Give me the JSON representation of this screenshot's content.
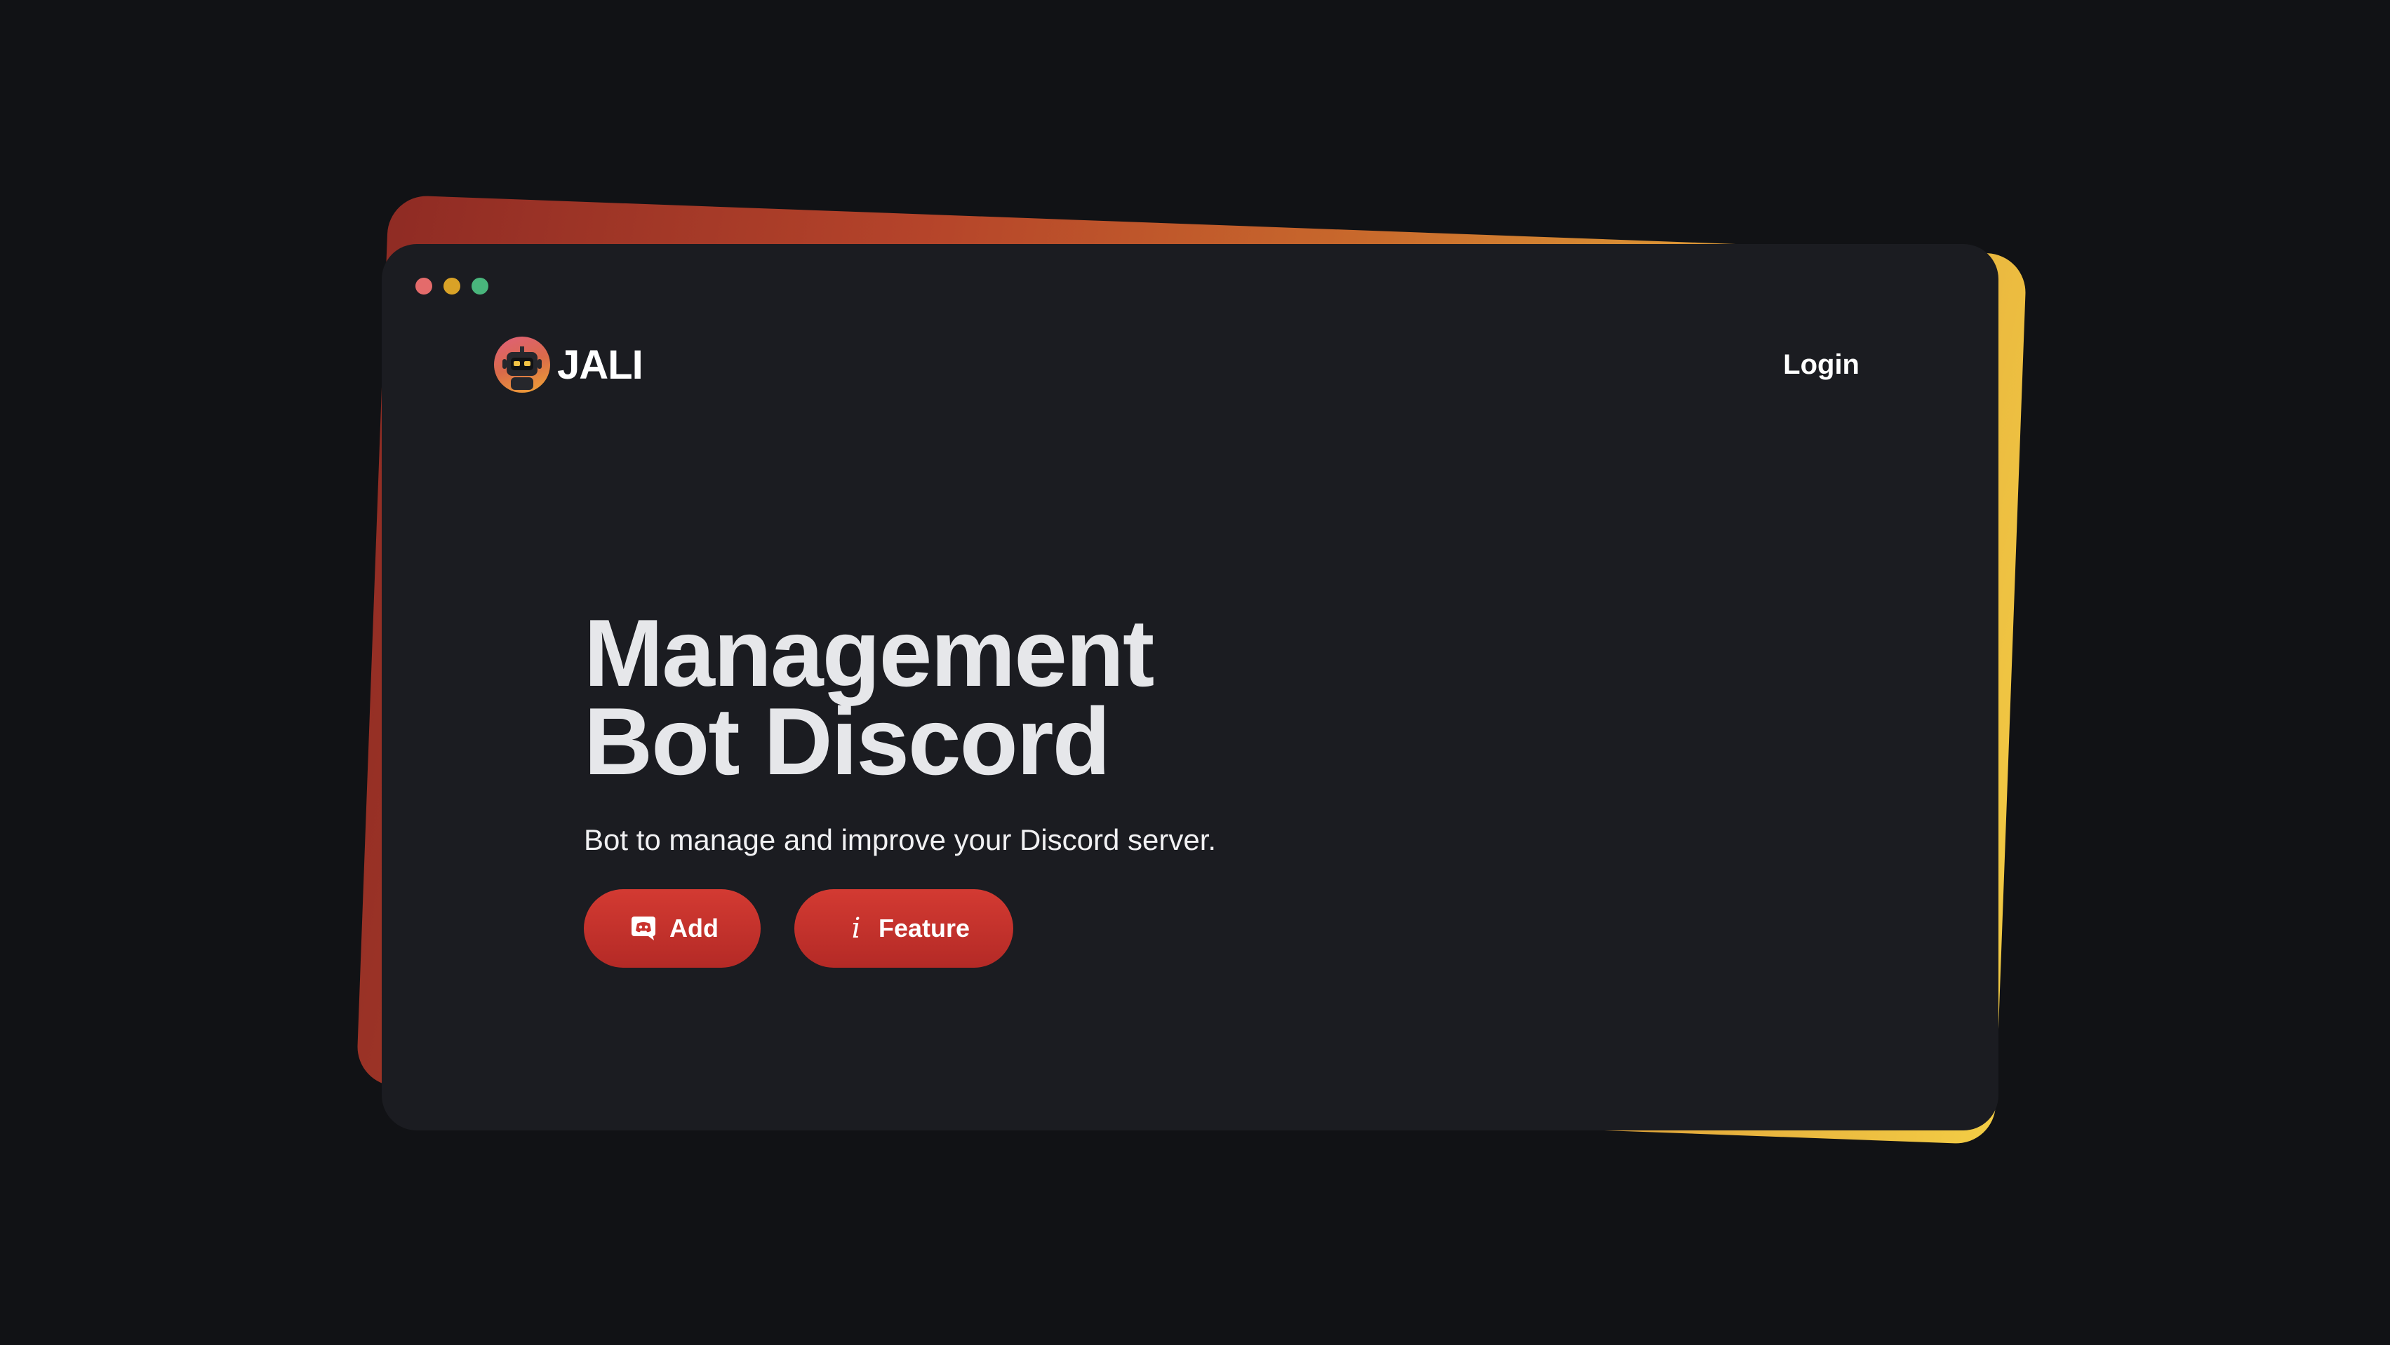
{
  "window": {
    "controls": [
      "close",
      "minimize",
      "maximize"
    ],
    "colors": {
      "close": "#e46b6b",
      "minimize": "#d9a227",
      "maximize": "#49b57c"
    }
  },
  "nav": {
    "brand": "JALI",
    "logo_icon": "robot-icon",
    "login_label": "Login"
  },
  "hero": {
    "title_line1": "Management",
    "title_line2": "Bot Discord",
    "subtitle": "Bot to manage and improve your Discord server.",
    "buttons": [
      {
        "label": "Add",
        "icon": "discord-icon"
      },
      {
        "label": "Feature",
        "icon": "info-icon",
        "glyph": "i"
      }
    ]
  },
  "theme": {
    "background": "#111215",
    "window_bg": "#1b1c21",
    "accent": "#c9322d",
    "backdrop_gradient": [
      "#8f2b24",
      "#c96a2c",
      "#f3cd45"
    ]
  }
}
